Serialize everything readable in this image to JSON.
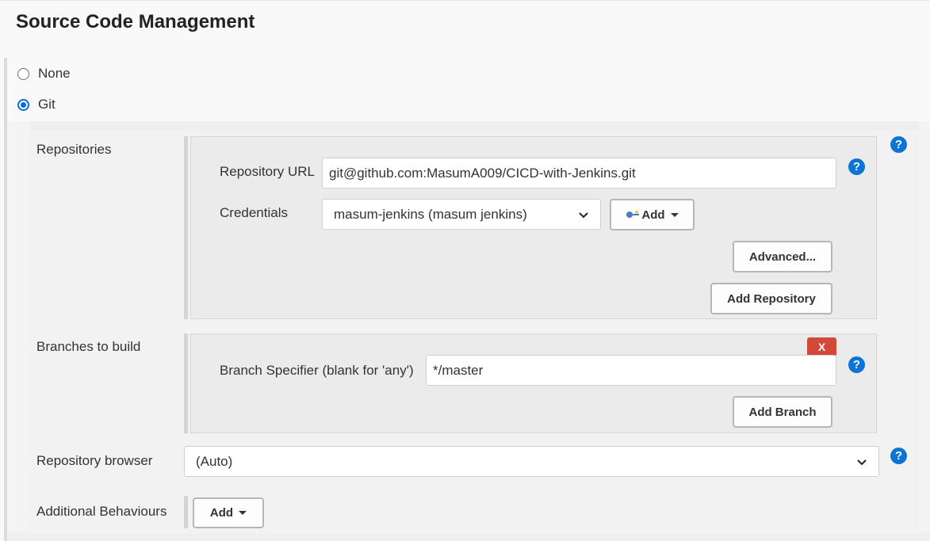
{
  "section": {
    "title": "Source Code Management"
  },
  "scm_options": [
    {
      "label": "None",
      "selected": false
    },
    {
      "label": "Git",
      "selected": true
    }
  ],
  "repositories": {
    "label": "Repositories",
    "url_label": "Repository URL",
    "url_value": "git@github.com:MasumA009/CICD-with-Jenkins.git",
    "credentials_label": "Credentials",
    "credentials_value": "masum-jenkins (masum jenkins)",
    "add_label": "Add",
    "advanced_label": "Advanced...",
    "add_repository_label": "Add Repository"
  },
  "branches": {
    "label": "Branches to build",
    "delete_label": "X",
    "specifier_label": "Branch Specifier (blank for 'any')",
    "specifier_value": "*/master",
    "add_branch_label": "Add Branch"
  },
  "repository_browser": {
    "label": "Repository browser",
    "value": "(Auto)"
  },
  "additional_behaviours": {
    "label": "Additional Behaviours",
    "add_label": "Add"
  },
  "help_glyph": "?",
  "colors": {
    "accent": "#0b75d6",
    "danger": "#d24939",
    "panel": "#ebebeb"
  },
  "icons": {
    "help": "question-circle-icon",
    "dropdown": "chevron-down-icon",
    "credentials_add": "key-icon",
    "caret": "caret-down-icon"
  }
}
